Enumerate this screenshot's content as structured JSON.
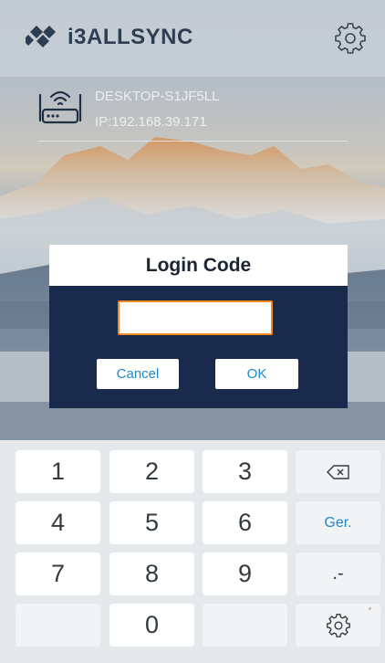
{
  "app": {
    "brand": "i3ALLSYNC",
    "settings_icon": "gear-icon"
  },
  "device": {
    "name": "DESKTOP-S1JF5LL",
    "ip": "IP:192.168.39.171",
    "icon": "router-icon"
  },
  "dialog": {
    "title": "Login Code",
    "code_value": "",
    "cancel_label": "Cancel",
    "ok_label": "OK"
  },
  "keypad": {
    "rows": [
      [
        "1",
        "2",
        "3",
        "⌫"
      ],
      [
        "4",
        "5",
        "6",
        "Ger."
      ],
      [
        "7",
        "8",
        "9",
        ".-"
      ],
      [
        "",
        "0",
        "",
        "gear-icon"
      ]
    ]
  },
  "colors": {
    "dialog_bg": "#1a2a4c",
    "input_border": "#ef8a1e",
    "accent": "#1e88c9"
  }
}
